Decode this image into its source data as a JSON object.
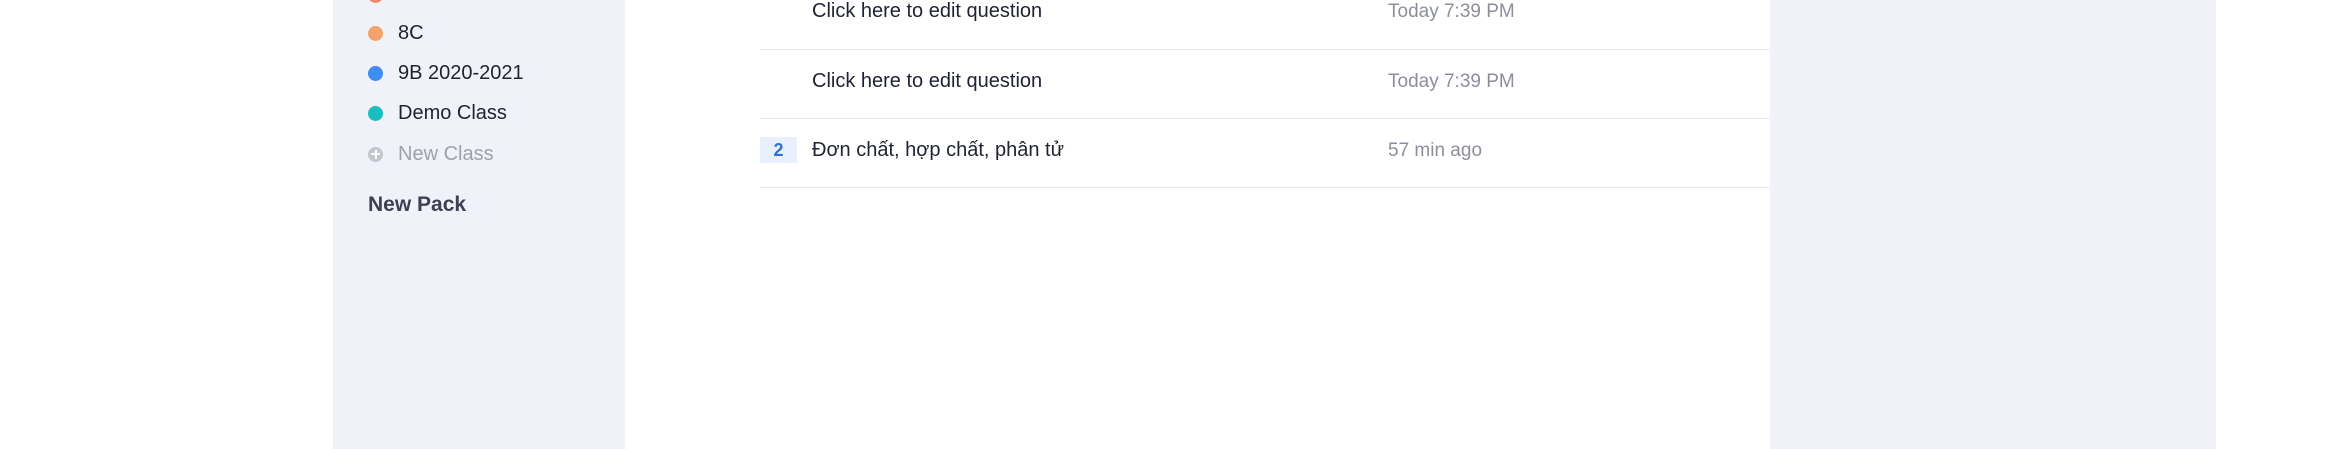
{
  "sidebar": {
    "classes": [
      {
        "label": "8C",
        "color": "#f4a26b"
      },
      {
        "label": "9B 2020-2021",
        "color": "#3d8ef0"
      },
      {
        "label": "Demo Class",
        "color": "#19bfbf"
      }
    ],
    "new_class_label": "New Class",
    "new_pack_label": "New Pack"
  },
  "questions": [
    {
      "number": "",
      "text": "Click here to edit question",
      "time": "Today 7:39 PM"
    },
    {
      "number": "",
      "text": "Click here to edit question",
      "time": "Today 7:39 PM"
    },
    {
      "number": "2",
      "text": "Đơn chất, hợp chất, phân tử",
      "time": "57 min ago"
    }
  ],
  "colors": {
    "sidebar_bg": "#f1f1fa",
    "badge_bg": "#e9f0fd",
    "badge_text": "#2f6fd6"
  }
}
